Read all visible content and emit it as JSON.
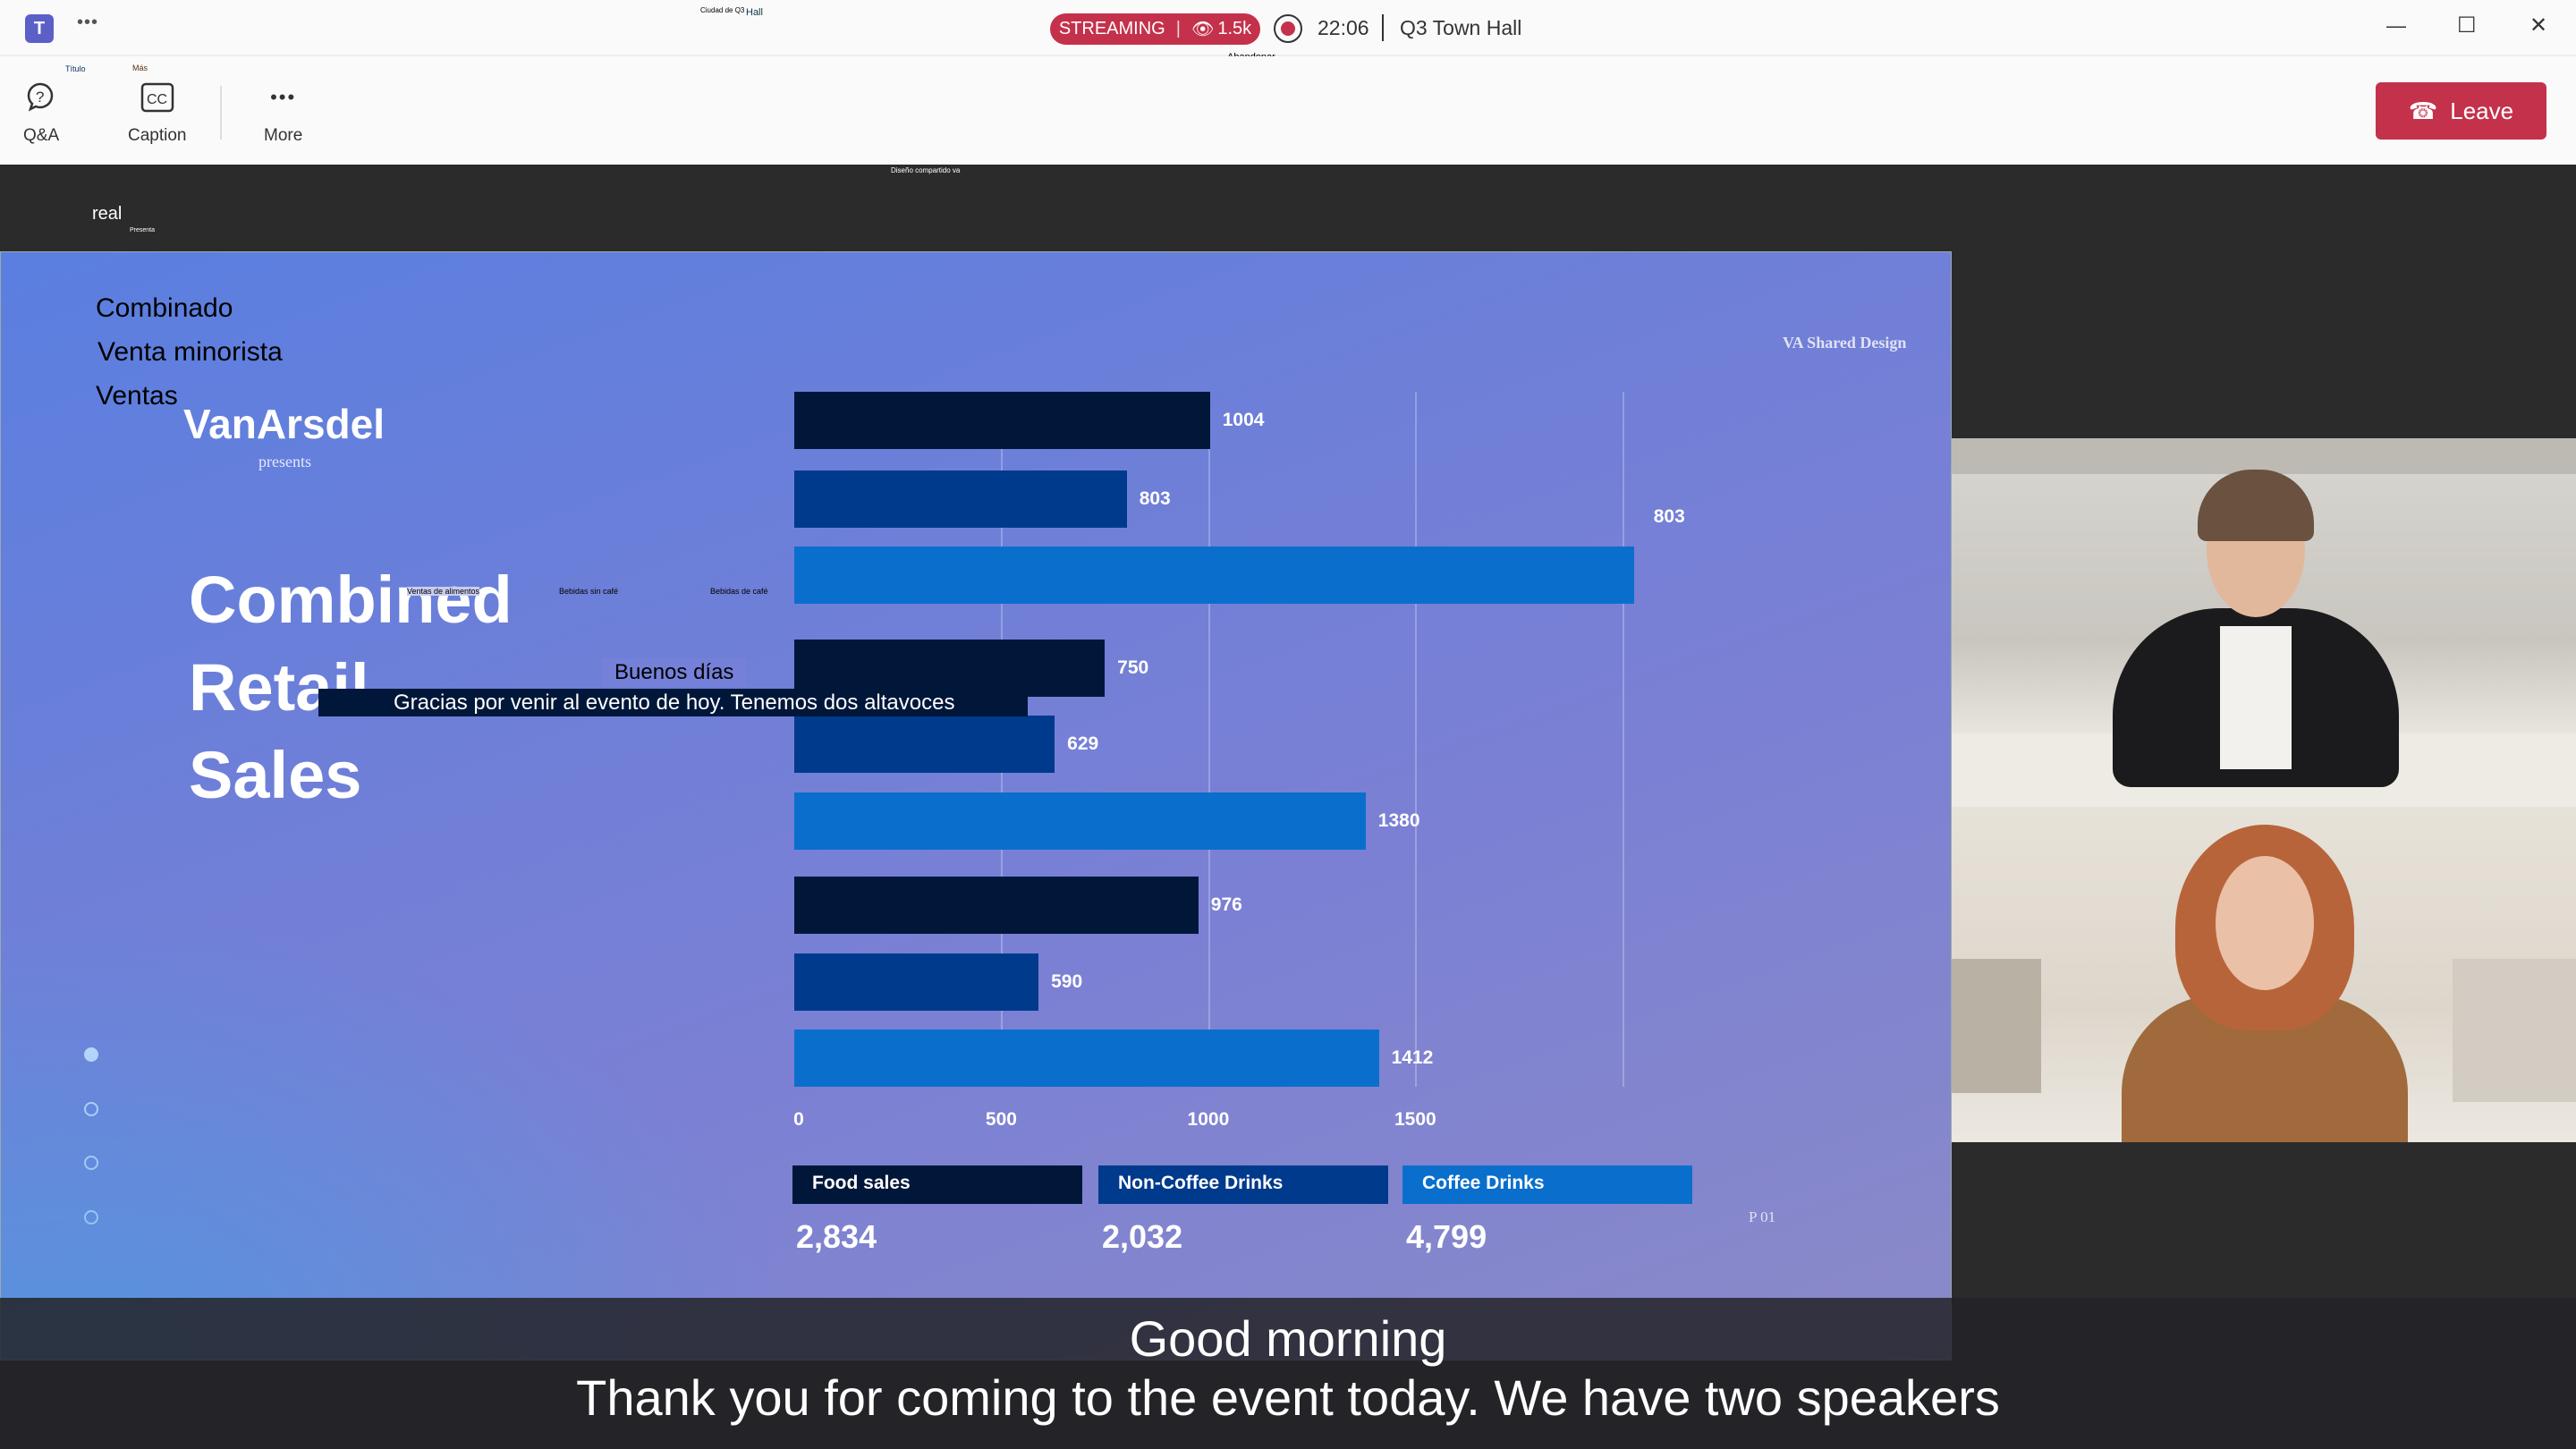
{
  "window": {
    "meeting_title": "Q3 Town Hall",
    "streaming_label": "STREAMING",
    "viewers": "1.5k",
    "elapsed": "22:06",
    "overlay_title_small": "Ciudad de Q3",
    "overlay_title_hall": "Hall",
    "leave_small": "Abandonar",
    "minimize": "—",
    "maximize": "☐",
    "close": "✕",
    "more_icon": "•••"
  },
  "toolbar": {
    "qa_label": "Q&A",
    "caption_label": "Caption",
    "more_label": "More",
    "qa_small": "Título",
    "caption_small": "Más",
    "leave_label": "Leave"
  },
  "stage": {
    "shared_small": "Diseño compartido va",
    "presenter_name": "real",
    "presenter_small": "Presenta"
  },
  "slide": {
    "side_labels": [
      "Combinado",
      "Venta minorista",
      "Ventas"
    ],
    "logo": "VanArsdel",
    "logo_sub": "presents",
    "title_lines": [
      "Combined",
      "Retail",
      "Sales"
    ],
    "brand": "VA Shared Design",
    "page": "P 01",
    "translated_series": [
      "Ventas de alimentos",
      "Bebidas sin café",
      "Bebidas de café"
    ],
    "translated_caption_line1": "Buenos días",
    "translated_caption_line2": "Gracias por venir al evento de hoy. Tenemos dos altavoces"
  },
  "chart_data": {
    "type": "bar",
    "orientation": "horizontal",
    "xlim": [
      0,
      2000
    ],
    "x_ticks": [
      "0",
      "500",
      "1000",
      "1500"
    ],
    "grid": true,
    "series_colors": {
      "Food sales": "#00173a",
      "Non-Coffee Drinks": "#003a8c",
      "Coffee Drinks": "#0a6fcc"
    },
    "bars": [
      {
        "series": "Food sales",
        "value": 1004,
        "label": "1004"
      },
      {
        "series": "Non-Coffee Drinks",
        "value": 803,
        "label": "803"
      },
      {
        "series": "Coffee Drinks",
        "value": 2028,
        "label": "803"
      },
      {
        "series": "Food sales",
        "value": 750,
        "label": "750"
      },
      {
        "series": "Non-Coffee Drinks",
        "value": 629,
        "label": "629"
      },
      {
        "series": "Coffee Drinks",
        "value": 1380,
        "label": "1380"
      },
      {
        "series": "Food sales",
        "value": 976,
        "label": "976"
      },
      {
        "series": "Non-Coffee Drinks",
        "value": 590,
        "label": "590"
      },
      {
        "series": "Coffee Drinks",
        "value": 1412,
        "label": "1412"
      }
    ],
    "legend": [
      {
        "name": "Food sales",
        "total": "2,834"
      },
      {
        "name": "Non-Coffee Drinks",
        "total": "2,032"
      },
      {
        "name": "Coffee Drinks",
        "total": "4,799"
      }
    ]
  },
  "captions": {
    "line1": "Good morning",
    "line2": "Thank you for coming to the event today. We have two speakers"
  },
  "colors": {
    "accent_red": "#c4314b",
    "teams_purple": "#5b5fc7"
  }
}
